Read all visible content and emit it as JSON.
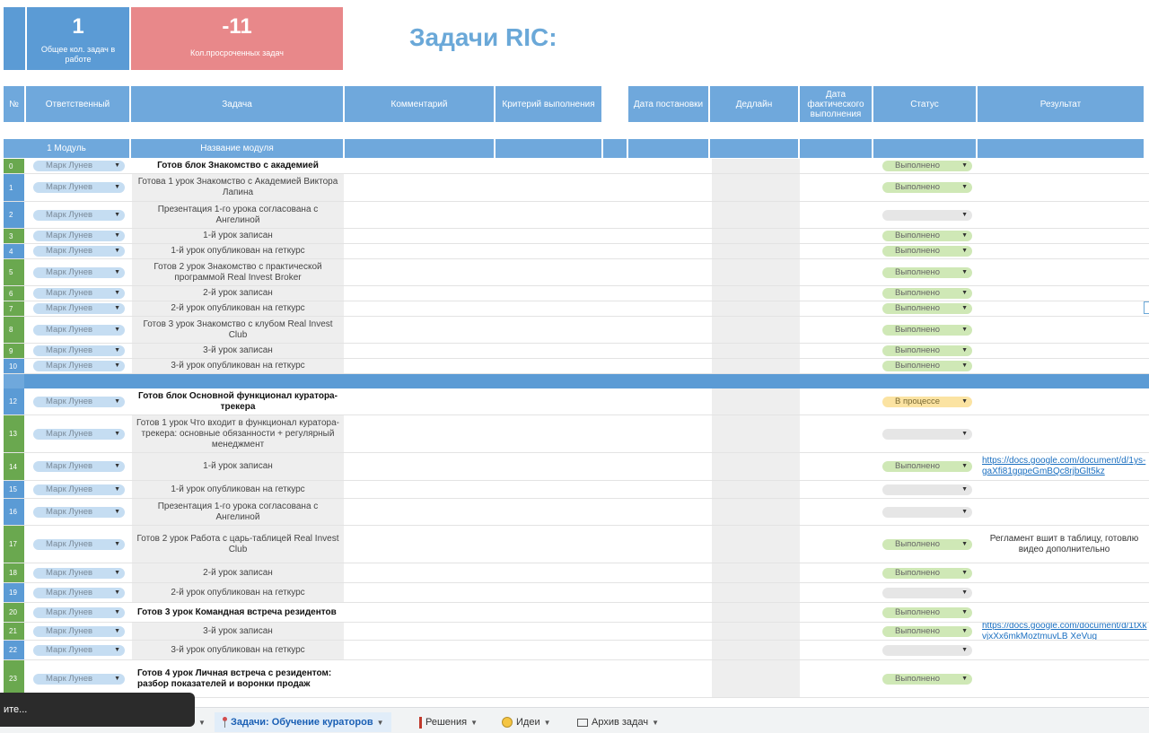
{
  "summary": {
    "total_value": "1",
    "total_caption": "Общее кол. задач в работе",
    "overdue_value": "-11",
    "overdue_caption": "Кол.просроченных задач"
  },
  "title": "Задачи RIC:",
  "columns": {
    "num": "№",
    "responsible": "Ответственный",
    "task": "Задача",
    "comment": "Комментарий",
    "criteria": "Критерий выполнения",
    "date_set": "Дата постановки",
    "deadline": "Дедлайн",
    "date_actual": "Дата фактического выполнения",
    "status": "Статус",
    "result": "Результат"
  },
  "module_header": {
    "module": "1 Модуль",
    "name": "Название модуля"
  },
  "rows": [
    {
      "n": "0",
      "person": "Марк Лунев",
      "task": "Готов блок Знакомство с академией",
      "status": "Выполнено",
      "result": ""
    },
    {
      "n": "1",
      "person": "Марк Лунев",
      "task": "Готова 1 урок Знакомство с Академией Виктора Лапина",
      "status": "Выполнено",
      "result": ""
    },
    {
      "n": "2",
      "person": "Марк Лунев",
      "task": "Презентация 1-го урока согласована с Ангелиной",
      "status": "",
      "result": ""
    },
    {
      "n": "3",
      "person": "Марк Лунев",
      "task": "1-й урок записан",
      "status": "Выполнено",
      "result": ""
    },
    {
      "n": "4",
      "person": "Марк Лунев",
      "task": "1-й урок опубликован на геткурс",
      "status": "Выполнено",
      "result": ""
    },
    {
      "n": "5",
      "person": "Марк Лунев",
      "task": "Готов 2 урок Знакомство с практической программой Real Invest Broker",
      "status": "Выполнено",
      "result": ""
    },
    {
      "n": "6",
      "person": "Марк Лунев",
      "task": "2-й урок записан",
      "status": "Выполнено",
      "result": ""
    },
    {
      "n": "7",
      "person": "Марк Лунев",
      "task": "2-й урок опубликован на геткурс",
      "status": "Выполнено",
      "result": ""
    },
    {
      "n": "8",
      "person": "Марк Лунев",
      "task": "Готов 3 урок Знакомство с клубом Real Invest Club",
      "status": "Выполнено",
      "result": ""
    },
    {
      "n": "9",
      "person": "Марк Лунев",
      "task": "3-й урок записан",
      "status": "Выполнено",
      "result": ""
    },
    {
      "n": "10",
      "person": "Марк Лунев",
      "task": "3-й урок опубликован на геткурс",
      "status": "Выполнено",
      "result": ""
    },
    {
      "n": "12",
      "person": "Марк Лунев",
      "task": "Готов блок Основной функционал куратора-трекера",
      "status": "В процессе",
      "result": ""
    },
    {
      "n": "13",
      "person": "Марк Лунев",
      "task": "Готов 1 урок Что входит в функционал куратора-трекера: основные обязанности + регулярный менеджмент",
      "status": "",
      "result": ""
    },
    {
      "n": "14",
      "person": "Марк Лунев",
      "task": "1-й урок записан",
      "status": "Выполнено",
      "result": "https://docs.google.com/document/d/1ys-gaXfi81gqpeGmBQc8rjbGlt5kz"
    },
    {
      "n": "15",
      "person": "Марк Лунев",
      "task": "1-й урок опубликован на геткурс",
      "status": "",
      "result": ""
    },
    {
      "n": "16",
      "person": "Марк Лунев",
      "task": "Презентация 1-го урока согласована с Ангелиной",
      "status": "",
      "result": ""
    },
    {
      "n": "17",
      "person": "Марк Лунев",
      "task": "Готов 2 урок Работа с царь-таблицей Real Invest Club",
      "status": "Выполнено",
      "result": "Регламент вшит в таблицу, готовлю видео дополнительно"
    },
    {
      "n": "18",
      "person": "Марк Лунев",
      "task": "2-й урок записан",
      "status": "Выполнено",
      "result": ""
    },
    {
      "n": "19",
      "person": "Марк Лунев",
      "task": "2-й урок опубликован на геткурс",
      "status": "",
      "result": ""
    },
    {
      "n": "20",
      "person": "Марк Лунев",
      "task": "Готов 3 урок Командная встреча резидентов",
      "status": "Выполнено",
      "result": ""
    },
    {
      "n": "21",
      "person": "Марк Лунев",
      "task": "3-й урок записан",
      "status": "Выполнено",
      "result": "https://docs.google.com/document/d/1tXkvjxXx6mkMoztmuvLB XeVug"
    },
    {
      "n": "22",
      "person": "Марк Лунев",
      "task": "3-й урок опубликован на геткурс",
      "status": "",
      "result": ""
    },
    {
      "n": "23",
      "person": "Марк Лунев",
      "task": "Готов 4 урок Личная встреча с резидентом: разбор показателей и воронки продаж",
      "status": "Выполнено",
      "result": ""
    }
  ],
  "tabs": {
    "toast": "ите...",
    "active": "Задачи: Обучение кураторов",
    "decisions": "Решения",
    "ideas": "Идеи",
    "archive": "Архив задач"
  },
  "icons": {
    "active_tab": "pin-icon",
    "decisions": "red-bar-icon",
    "ideas": "lightbulb-icon",
    "archive": "box-icon",
    "dropdown": "triangle-down-icon"
  },
  "colors": {
    "header_blue": "#6fa8dc",
    "overdue_red": "#e8888a",
    "done_green": "#cfe8b6",
    "progress_yellow": "#fbe3a2",
    "title_blue": "#6aa8d8"
  }
}
